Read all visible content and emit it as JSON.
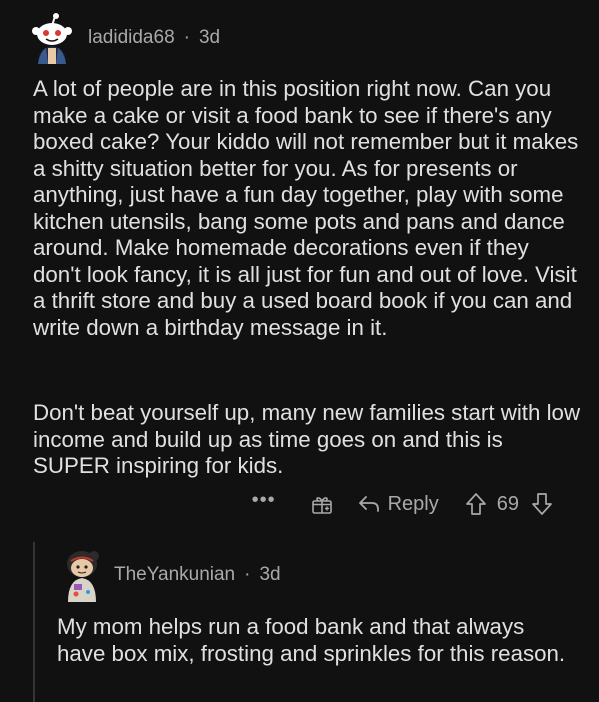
{
  "comment": {
    "username": "ladidida68",
    "separator": "·",
    "age": "3d",
    "paragraphs": [
      "A lot of people are in this position right now. Can you make a cake or visit a food bank to see if there's any boxed cake? Your kiddo will not remember but it makes a shitty situation better for you. As for presents or anything, just have a fun day together, play with some kitchen utensils, bang some pots and pans and dance around. Make homemade decorations even if they don't look fancy, it is all just for fun and out of love. Visit a thrift store and buy a used board book if you can and write down a birthday message in it.",
      "Don't beat yourself up, many new families start with low income and build up as time goes on and this is SUPER inspiring for kids."
    ],
    "actions": {
      "more_label": "•••",
      "award_icon": "gift-plus-icon",
      "reply_label": "Reply",
      "vote_count": "69"
    }
  },
  "reply": {
    "username": "TheYankunian",
    "separator": "·",
    "age": "3d",
    "text": "My mom helps run a food bank and that always have box mix, frosting and sprinkles for this reason."
  },
  "colors": {
    "background": "#111111",
    "text": "#e0e0e0",
    "muted": "#a9a9a9",
    "thread_line": "#343536"
  }
}
